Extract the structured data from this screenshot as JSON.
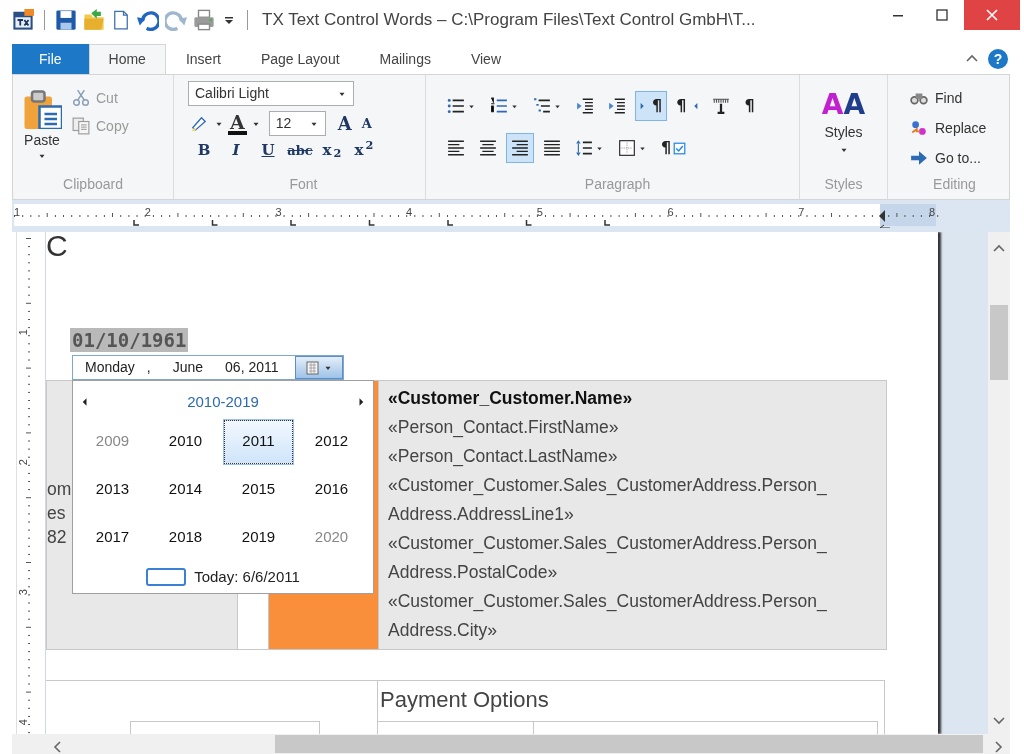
{
  "window": {
    "title": "TX Text Control Words – C:\\Program Files\\Text Control GmbH\\T...",
    "help_glyph": "?"
  },
  "tabs": [
    {
      "label": "File",
      "kind": "file",
      "selected": false
    },
    {
      "label": "Home",
      "kind": "tab",
      "selected": true
    },
    {
      "label": "Insert",
      "kind": "tab",
      "selected": false
    },
    {
      "label": "Page Layout",
      "kind": "tab",
      "selected": false
    },
    {
      "label": "Mailings",
      "kind": "tab",
      "selected": false
    },
    {
      "label": "View",
      "kind": "tab",
      "selected": false
    }
  ],
  "ribbon": {
    "clipboard": {
      "label": "Clipboard",
      "paste": "Paste",
      "items": [
        {
          "label": "Cut",
          "kind": "cut",
          "disabled": true
        },
        {
          "label": "Copy",
          "kind": "copy",
          "disabled": true
        }
      ]
    },
    "font": {
      "label": "Font",
      "font_name": "Calibri Light",
      "font_size": "12",
      "color_glyph": "A",
      "grow_glyph": "A",
      "shrink_glyph": "A",
      "format": [
        {
          "glyph": "B",
          "kind": "bold"
        },
        {
          "glyph": "I",
          "kind": "italic"
        },
        {
          "glyph": "U",
          "kind": "underline"
        },
        {
          "glyph": "abc",
          "kind": "strike"
        },
        {
          "glyph": "x$_{2}$",
          "kind": "sub"
        },
        {
          "glyph": "x$^{2}$",
          "kind": "sup"
        }
      ]
    },
    "paragraph": {
      "label": "Paragraph",
      "rows": [
        [
          {
            "kind": "bullets",
            "dropdown": true,
            "selected": false
          },
          {
            "kind": "numbering",
            "dropdown": true,
            "selected": false
          },
          {
            "kind": "multilevel",
            "dropdown": true,
            "selected": false
          },
          {
            "kind": "outdent",
            "dropdown": false,
            "selected": false
          },
          {
            "kind": "indent",
            "dropdown": false,
            "selected": false
          },
          {
            "kind": "ltr",
            "glyph": "¶",
            "dropdown": false,
            "selected": true
          },
          {
            "kind": "rtl",
            "glyph": "¶",
            "dropdown": false,
            "selected": false
          },
          {
            "kind": "tabs",
            "dropdown": false,
            "selected": false
          },
          {
            "kind": "marks",
            "glyph": "¶",
            "dropdown": false,
            "selected": false
          }
        ],
        [
          {
            "kind": "align-left",
            "dropdown": false,
            "selected": false
          },
          {
            "kind": "align-center",
            "dropdown": false,
            "selected": false
          },
          {
            "kind": "align-right",
            "dropdown": false,
            "selected": true
          },
          {
            "kind": "justify",
            "dropdown": false,
            "selected": false
          },
          {
            "kind": "spacing",
            "dropdown": true,
            "selected": false
          },
          {
            "kind": "borders",
            "dropdown": true,
            "selected": false
          },
          {
            "kind": "format",
            "glyph": "¶",
            "dropdown": false,
            "selected": false
          }
        ]
      ]
    },
    "styles": {
      "label": "Styles",
      "glyph": "AA",
      "button": "Styles"
    },
    "editing": {
      "label": "Editing",
      "items": [
        {
          "label": "Find",
          "kind": "find"
        },
        {
          "label": "Replace",
          "kind": "replace"
        },
        {
          "label": "Go to...",
          "kind": "goto"
        }
      ]
    }
  },
  "ruler": {
    "horizontal": [
      "1",
      "2",
      "3",
      "4",
      "5",
      "6",
      "7",
      "8"
    ],
    "vertical": [
      "1",
      "2",
      "3",
      "4"
    ]
  },
  "document": {
    "top_char": "C",
    "date_field": "01/10/1961",
    "date_picker": {
      "parts": [
        "Monday",
        ",",
        "June",
        "06, 2011"
      ]
    },
    "calendar": {
      "header": "2010-2019",
      "today": "Today: 6/6/2011",
      "years": [
        {
          "label": "2009",
          "outside": true,
          "selected": false
        },
        {
          "label": "2010",
          "outside": false,
          "selected": false
        },
        {
          "label": "2011",
          "outside": false,
          "selected": true
        },
        {
          "label": "2012",
          "outside": false,
          "selected": false
        },
        {
          "label": "2013",
          "outside": false,
          "selected": false
        },
        {
          "label": "2014",
          "outside": false,
          "selected": false
        },
        {
          "label": "2015",
          "outside": false,
          "selected": false
        },
        {
          "label": "2016",
          "outside": false,
          "selected": false
        },
        {
          "label": "2017",
          "outside": false,
          "selected": false
        },
        {
          "label": "2018",
          "outside": false,
          "selected": false
        },
        {
          "label": "2019",
          "outside": false,
          "selected": false
        },
        {
          "label": "2020",
          "outside": true,
          "selected": false
        }
      ]
    },
    "left_fragments": [
      "om",
      "es",
      "82"
    ],
    "merge_fields": [
      {
        "text": "«Customer_Customer.Name»",
        "bold": true
      },
      {
        "text": "«Person_Contact.FirstName»",
        "bold": false
      },
      {
        "text": "«Person_Contact.LastName»",
        "bold": false
      },
      {
        "text": "«Customer_Customer.Sales_CustomerAddress.Person_",
        "bold": false
      },
      {
        "text": "Address.AddressLine1»",
        "bold": false
      },
      {
        "text": "«Customer_Customer.Sales_CustomerAddress.Person_",
        "bold": false
      },
      {
        "text": "Address.PostalCode»",
        "bold": false
      },
      {
        "text": "«Customer_Customer.Sales_CustomerAddress.Person_",
        "bold": false
      },
      {
        "text": "Address.City»",
        "bold": false
      }
    ],
    "payment_heading": "Payment Options"
  }
}
